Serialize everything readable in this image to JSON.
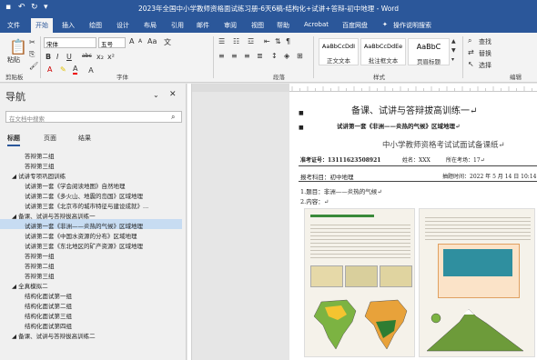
{
  "window": {
    "title": "2023年全国中小学教师资格面试练习册-6天6稿-结构化+试讲+答辩-初中地理 - Word"
  },
  "menu": {
    "tabs": [
      "文件",
      "开始",
      "插入",
      "绘图",
      "设计",
      "布局",
      "引用",
      "邮件",
      "审阅",
      "视图",
      "帮助",
      "Acrobat",
      "百度网盘"
    ],
    "active": "开始",
    "tellme": "操作说明搜索"
  },
  "ribbon": {
    "clipboard": {
      "paste": "粘贴",
      "label": "剪贴板"
    },
    "font": {
      "name": "宋体",
      "size": "五号",
      "label": "字体",
      "bold": "B",
      "italic": "I",
      "underline": "U",
      "strike": "abc",
      "sub": "x₂",
      "sup": "x²",
      "grow": "A",
      "shrink": "A",
      "color_a": "A",
      "aa": "Aa",
      "wen": "文"
    },
    "paragraph": {
      "label": "段落"
    },
    "styles": {
      "label": "样式",
      "items": [
        {
          "preview": "AaBbCcDdI",
          "name": "↵ 正文"
        },
        {
          "preview": "AaBbCcDdEe",
          "name": "↵ 无间隔"
        },
        {
          "preview": "AaBbC",
          "name": "标题 1"
        }
      ],
      "extra_a": "正文文本",
      "extra_b": "批注框文本",
      "extra_c": "页眉标题"
    },
    "editing": {
      "find": "查找",
      "replace": "替换",
      "select": "选择",
      "label": "编辑"
    }
  },
  "nav": {
    "title": "导航",
    "search_placeholder": "在文档中搜索",
    "tabs": [
      "标题",
      "页面",
      "结果"
    ],
    "items": [
      {
        "text": "答辩第二组",
        "indent": 3,
        "selected": false
      },
      {
        "text": "答辩第三组",
        "indent": 3,
        "selected": false
      },
      {
        "text": "◢ 试讲专项巩固训练",
        "indent": 1,
        "selected": false
      },
      {
        "text": "试讲第一套《学会阅读地图》自然地理",
        "indent": 3,
        "selected": false
      },
      {
        "text": "试讲第二套《多火山、地震的岛国》区域地理",
        "indent": 3,
        "selected": false
      },
      {
        "text": "试讲第三套《北京市的城市特征与建设成就》...",
        "indent": 3,
        "selected": false
      },
      {
        "text": "◢ 备课、试讲与答辩拔高训练一",
        "indent": 1,
        "selected": false
      },
      {
        "text": "试讲第一套《非洲——炎热的气候》区域地理",
        "indent": 3,
        "selected": true
      },
      {
        "text": "试讲第二套《中国水资源的分布》区域地理",
        "indent": 3,
        "selected": false
      },
      {
        "text": "试讲第三套《东北地区的矿产资源》区域地理",
        "indent": 3,
        "selected": false
      },
      {
        "text": "答辩第一组",
        "indent": 3,
        "selected": false
      },
      {
        "text": "答辩第二组",
        "indent": 3,
        "selected": false
      },
      {
        "text": "答辩第三组",
        "indent": 3,
        "selected": false
      },
      {
        "text": "◢ 全真模拟二",
        "indent": 1,
        "selected": false
      },
      {
        "text": "结构化面试第一组",
        "indent": 3,
        "selected": false
      },
      {
        "text": "结构化面试第二组",
        "indent": 3,
        "selected": false
      },
      {
        "text": "结构化面试第三组",
        "indent": 3,
        "selected": false
      },
      {
        "text": "结构化面试第四组",
        "indent": 3,
        "selected": false
      },
      {
        "text": "◢ 备课、试讲与答辩拔高训练二",
        "indent": 1,
        "selected": false
      }
    ]
  },
  "document": {
    "heading": "备课、试讲与答辩拔高训练一↵",
    "subheading": "试讲第一套《非洲——炎热的气候》区域地理↵",
    "form_title": "中小学教师资格考试试面试备课纸↵",
    "candidate": "准考证号：13111623508921",
    "name": "姓名：XXX",
    "room": "所在考场：17↵",
    "subject": "报考科目：初中地理",
    "time": "抽题时间：2022 年 5 月 14 日 10:14",
    "topic": "1.题目：非洲——炎热的气候↵",
    "content": "2.内容：↵"
  },
  "status": {
    "text": "第 53 页，共 96 页  23946 个字  中文(中国)  辅助功能: 调查"
  }
}
